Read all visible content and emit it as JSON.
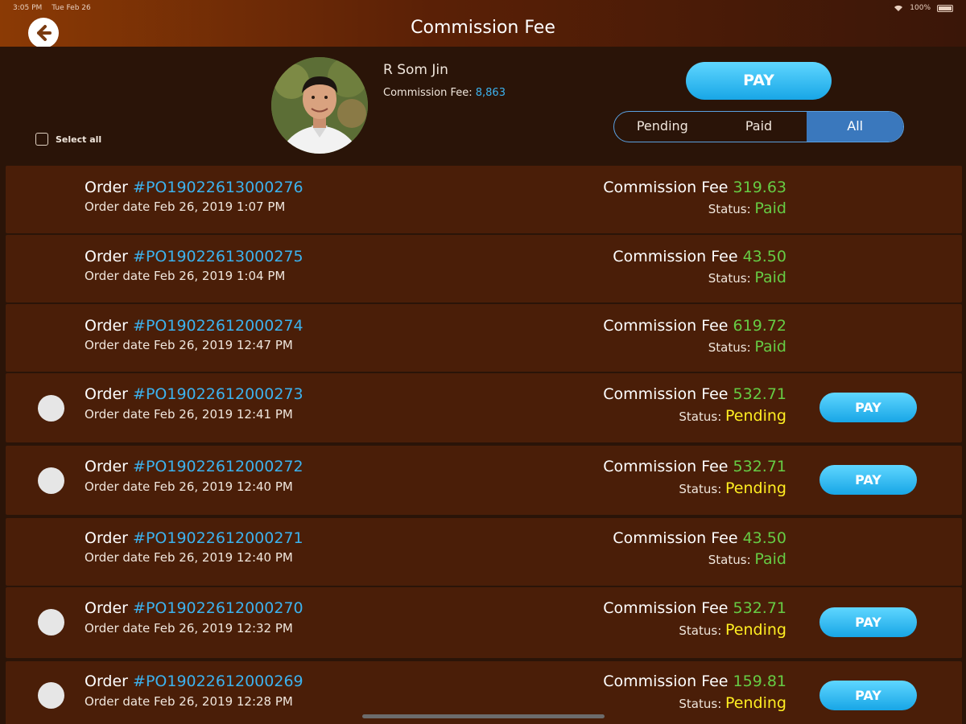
{
  "status_bar": {
    "time": "3:05 PM",
    "date": "Tue Feb 26",
    "battery": "100%"
  },
  "nav": {
    "title": "Commission Fee",
    "back_icon": "arrow-left-icon"
  },
  "profile": {
    "name": "R Som Jin",
    "fee_label": "Commission Fee:",
    "fee_value": "8,863"
  },
  "select_all_label": "Select all",
  "pay_label": "PAY",
  "segments": [
    {
      "label": "Pending",
      "active": false
    },
    {
      "label": "Paid",
      "active": false
    },
    {
      "label": "All",
      "active": true
    }
  ],
  "orders": [
    {
      "order_label": "Order",
      "number": "#PO19022613000276",
      "date": "Order date Feb 26, 2019 1:07 PM",
      "fee_label": "Commission Fee",
      "fee": "319.63",
      "status_label": "Status:",
      "status": "Paid",
      "selectable": false,
      "pay": ""
    },
    {
      "order_label": "Order",
      "number": "#PO19022613000275",
      "date": "Order date Feb 26, 2019 1:04 PM",
      "fee_label": "Commission Fee",
      "fee": "43.50",
      "status_label": "Status:",
      "status": "Paid",
      "selectable": false,
      "pay": ""
    },
    {
      "order_label": "Order",
      "number": "#PO19022612000274",
      "date": "Order date Feb 26, 2019 12:47 PM",
      "fee_label": "Commission Fee",
      "fee": "619.72",
      "status_label": "Status:",
      "status": "Paid",
      "selectable": false,
      "pay": ""
    },
    {
      "order_label": "Order",
      "number": "#PO19022612000273",
      "date": "Order date Feb 26, 2019 12:41 PM",
      "fee_label": "Commission Fee",
      "fee": "532.71",
      "status_label": "Status:",
      "status": "Pending",
      "selectable": true,
      "pay": "PAY"
    },
    {
      "order_label": "Order",
      "number": "#PO19022612000272",
      "date": "Order date Feb 26, 2019 12:40 PM",
      "fee_label": "Commission Fee",
      "fee": "532.71",
      "status_label": "Status:",
      "status": "Pending",
      "selectable": true,
      "pay": "PAY"
    },
    {
      "order_label": "Order",
      "number": "#PO19022612000271",
      "date": "Order date Feb 26, 2019 12:40 PM",
      "fee_label": "Commission Fee",
      "fee": "43.50",
      "status_label": "Status:",
      "status": "Paid",
      "selectable": false,
      "pay": ""
    },
    {
      "order_label": "Order",
      "number": "#PO19022612000270",
      "date": "Order date Feb 26, 2019 12:32 PM",
      "fee_label": "Commission Fee",
      "fee": "532.71",
      "status_label": "Status:",
      "status": "Pending",
      "selectable": true,
      "pay": "PAY"
    },
    {
      "order_label": "Order",
      "number": "#PO19022612000269",
      "date": "Order date Feb 26, 2019 12:28 PM",
      "fee_label": "Commission Fee",
      "fee": "159.81",
      "status_label": "Status:",
      "status": "Pending",
      "selectable": true,
      "pay": "PAY"
    }
  ],
  "colors": {
    "background": "#2a1408",
    "row": "#4a1e08",
    "accent_blue": "#3cb2ee",
    "paid_green": "#66cc44",
    "pending_yellow": "#ffee22"
  }
}
